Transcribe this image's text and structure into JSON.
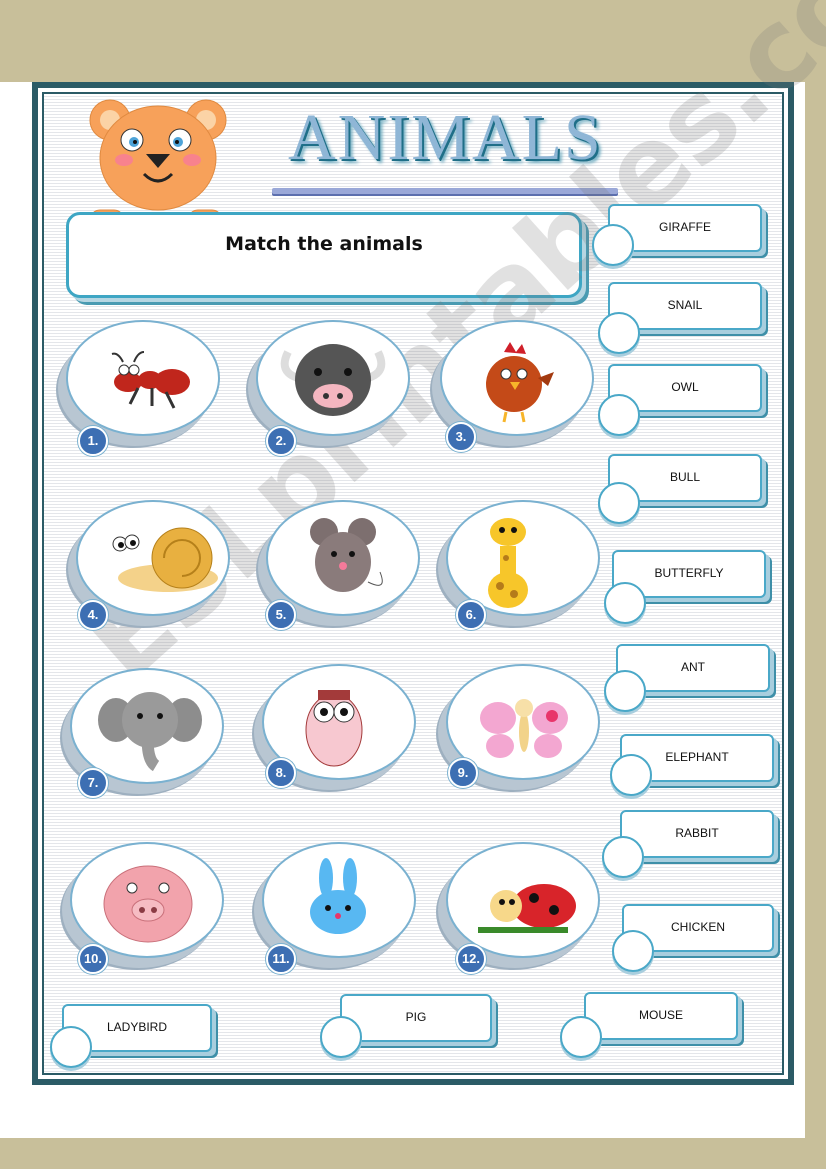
{
  "title": "ANIMALS",
  "instruction": "Match the animals",
  "numbers": [
    "1.",
    "2.",
    "3.",
    "4.",
    "5.",
    "6.",
    "7.",
    "8.",
    "9.",
    "10.",
    "11.",
    "12."
  ],
  "word_bank": [
    "GIRAFFE",
    "SNAIL",
    "OWL",
    "BULL",
    "BUTTERFLY",
    "ANT",
    "ELEPHANT",
    "RABBIT",
    "CHICKEN",
    "LADYBIRD",
    "PIG",
    "MOUSE"
  ],
  "watermark": "ESLprintables.com",
  "pictures": [
    "ant-icon",
    "bull-icon",
    "chicken-icon",
    "snail-icon",
    "mouse-icon",
    "giraffe-icon",
    "elephant-icon",
    "owl-icon",
    "butterfly-icon",
    "pig-icon",
    "rabbit-icon",
    "ladybird-icon"
  ],
  "colors": {
    "frame": "#2b5b66",
    "accent": "#4aa8c8",
    "number_badge": "#3d6fb3"
  }
}
